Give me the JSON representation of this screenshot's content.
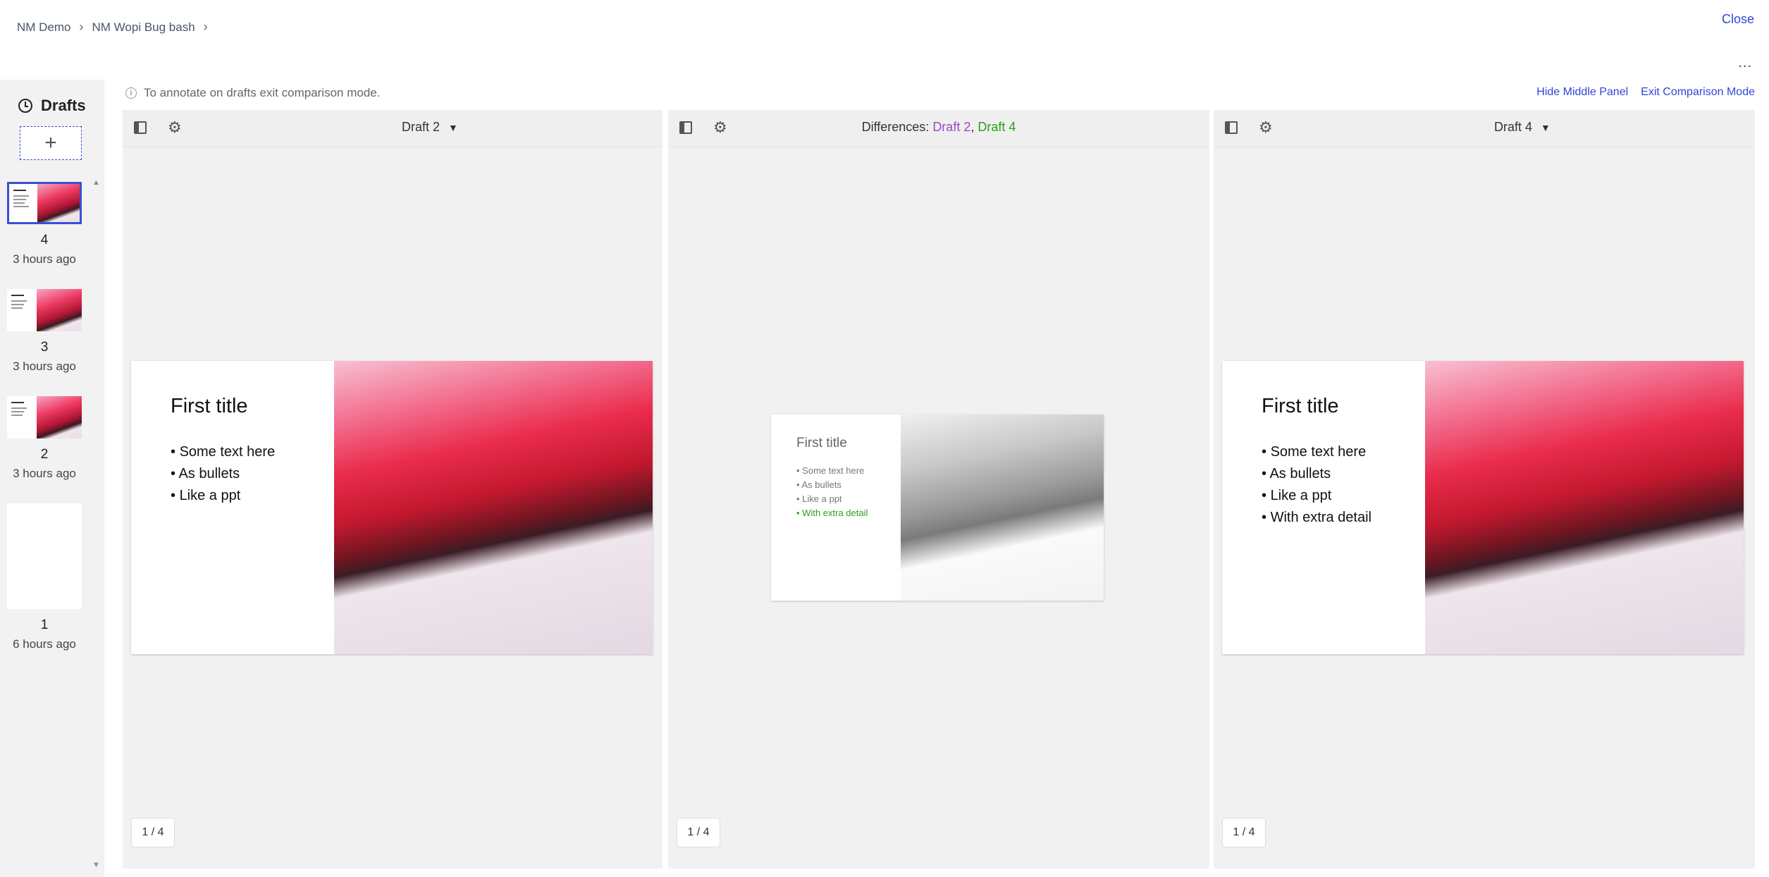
{
  "breadcrumb": {
    "items": [
      "NM Demo",
      "NM Wopi Bug bash"
    ]
  },
  "header": {
    "close_label": "Close",
    "more_label": "..."
  },
  "sidebar": {
    "title": "Drafts",
    "add_label": "+",
    "items": [
      {
        "number": "4",
        "time": "3 hours ago",
        "selected": true
      },
      {
        "number": "3",
        "time": "3 hours ago",
        "selected": false
      },
      {
        "number": "2",
        "time": "3 hours ago",
        "selected": false
      },
      {
        "number": "1",
        "time": "6 hours ago",
        "selected": false,
        "blank": true
      }
    ]
  },
  "info": {
    "text": "To annotate on drafts exit comparison mode."
  },
  "actions": {
    "hide_middle": "Hide Middle Panel",
    "exit_compare": "Exit Comparison Mode"
  },
  "panels": {
    "left": {
      "draft_label": "Draft 2",
      "pager": "1 / 4"
    },
    "middle": {
      "diff_prefix": "Differences:",
      "old": "Draft 2",
      "comma": ",",
      "new": "Draft 4",
      "pager": "1 / 4"
    },
    "right": {
      "draft_label": "Draft 4",
      "pager": "1 / 4"
    }
  },
  "slides": {
    "left": {
      "title": "First title",
      "bullets": [
        "Some text here",
        "As bullets",
        "Like a ppt"
      ]
    },
    "middle": {
      "title": "First title",
      "bullets": [
        "Some text here",
        "As bullets",
        "Like a ppt"
      ],
      "added": [
        "With extra detail"
      ]
    },
    "right": {
      "title": "First title",
      "bullets": [
        "Some text here",
        "As bullets",
        "Like a ppt",
        "With extra detail"
      ]
    }
  },
  "colors": {
    "accent": "#3146d6",
    "old_draft": "#9b48c7",
    "new_draft": "#2aa01a"
  }
}
